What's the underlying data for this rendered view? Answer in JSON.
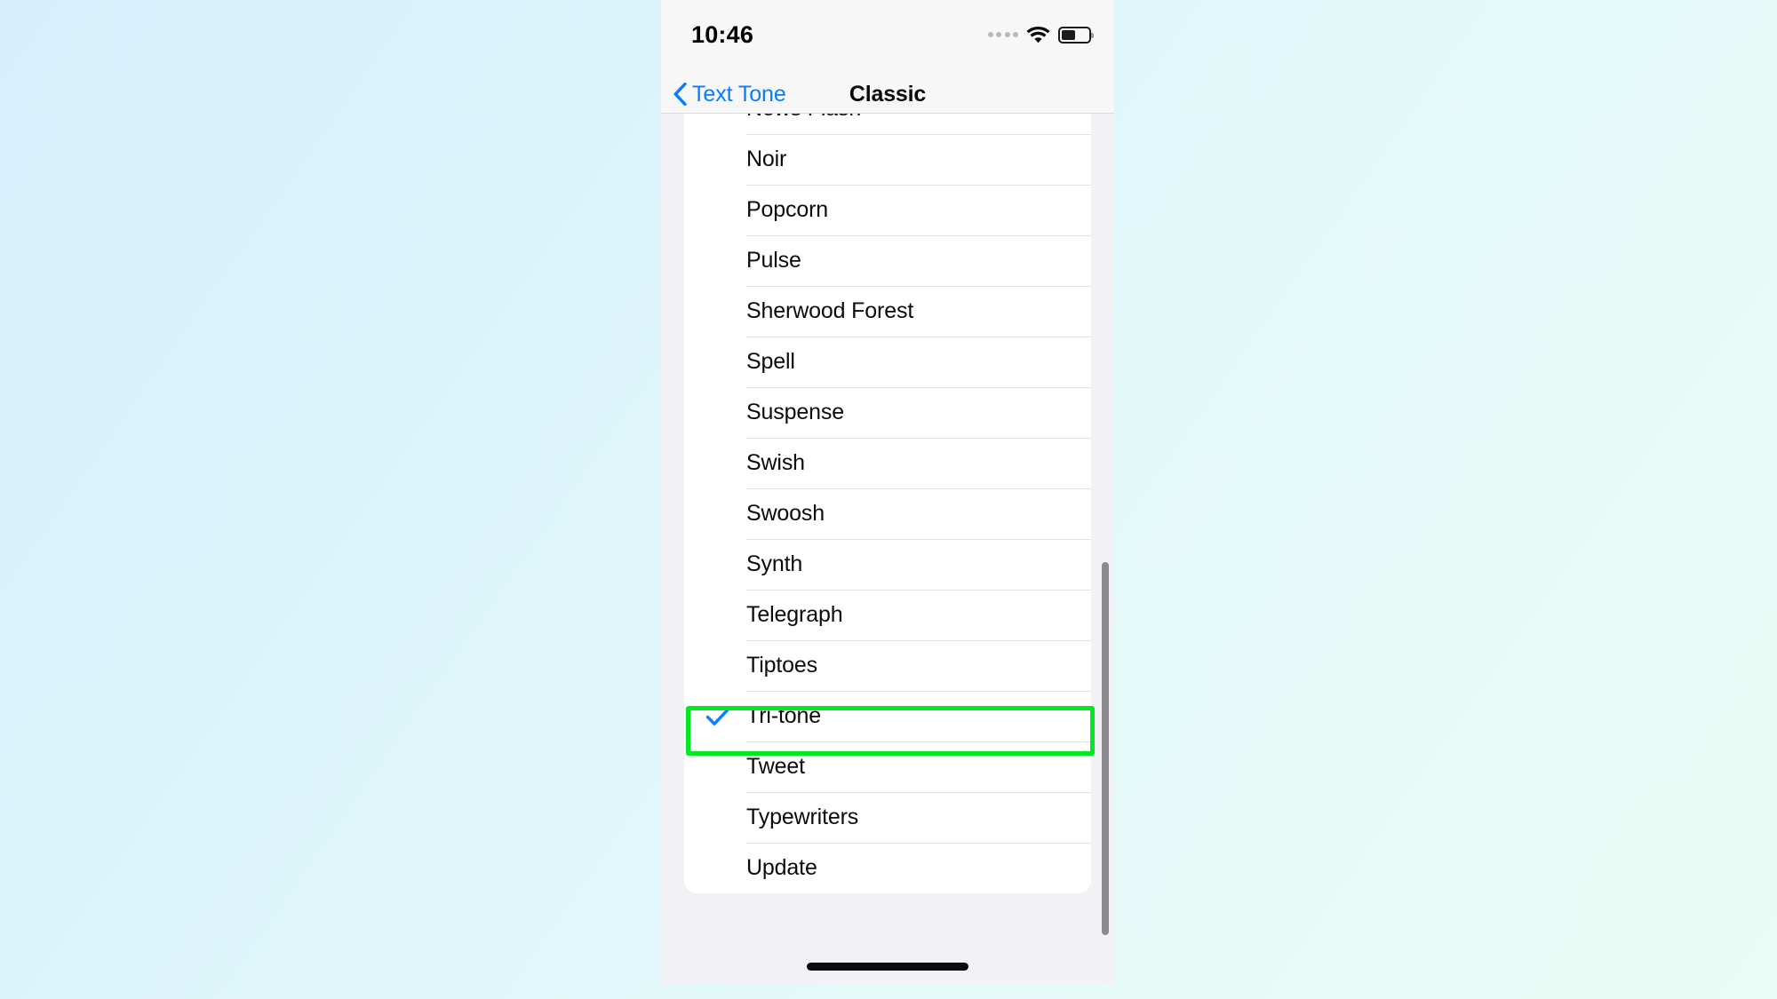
{
  "background": {
    "gradient_from": "#d5effd",
    "gradient_to": "#e9fcf6"
  },
  "statusbar": {
    "time": "10:46",
    "signal_icon": "signal-dots-icon",
    "wifi_icon": "wifi-icon",
    "battery_icon": "battery-icon",
    "battery_level_percent": 52
  },
  "navbar": {
    "back_label": "Text Tone",
    "back_icon": "chevron-left-icon",
    "title": "Classic",
    "back_color": "#0a7cff",
    "title_color": "#0b0b0c"
  },
  "list": {
    "selected_value": "Tri-tone",
    "check_icon": "checkmark-icon",
    "check_color": "#0a7cff",
    "items": [
      {
        "label": "News Flash",
        "selected": false
      },
      {
        "label": "Noir",
        "selected": false
      },
      {
        "label": "Popcorn",
        "selected": false
      },
      {
        "label": "Pulse",
        "selected": false
      },
      {
        "label": "Sherwood Forest",
        "selected": false
      },
      {
        "label": "Spell",
        "selected": false
      },
      {
        "label": "Suspense",
        "selected": false
      },
      {
        "label": "Swish",
        "selected": false
      },
      {
        "label": "Swoosh",
        "selected": false
      },
      {
        "label": "Synth",
        "selected": false
      },
      {
        "label": "Telegraph",
        "selected": false
      },
      {
        "label": "Tiptoes",
        "selected": false
      },
      {
        "label": "Tri-tone",
        "selected": true
      },
      {
        "label": "Tweet",
        "selected": false
      },
      {
        "label": "Typewriters",
        "selected": false
      },
      {
        "label": "Update",
        "selected": false
      }
    ]
  },
  "highlight": {
    "target": "Tri-tone",
    "color": "#00e821"
  },
  "scrollbar": {
    "color": "#8a8a90"
  },
  "home_indicator": {
    "label": "home-indicator"
  }
}
